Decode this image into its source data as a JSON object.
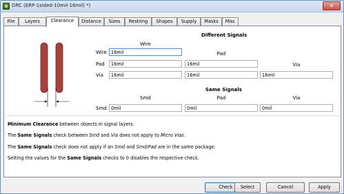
{
  "window": {
    "title": "DRC (ERP-1sided-10mil-16mil) *)",
    "close_label": "✕"
  },
  "tabs": [
    {
      "label": "File"
    },
    {
      "label": "Layers"
    },
    {
      "label": "Clearance"
    },
    {
      "label": "Distance"
    },
    {
      "label": "Sizes"
    },
    {
      "label": "Restring"
    },
    {
      "label": "Shapes"
    },
    {
      "label": "Supply"
    },
    {
      "label": "Masks"
    },
    {
      "label": "Misc"
    }
  ],
  "active_tab": "Clearance",
  "different_signals": {
    "title": "Different Signals",
    "col_wire": "Wire",
    "col_pad": "Pad",
    "col_via": "Via",
    "row_wire": "Wire",
    "row_pad": "Pad",
    "row_via": "Via",
    "wire_wire": "16mil",
    "pad_wire": "16mil",
    "pad_pad": "16mil",
    "via_wire": "16mil",
    "via_pad": "16mil",
    "via_via": "16mil"
  },
  "same_signals": {
    "title": "Same Signals",
    "col_smd": "Smd",
    "col_pad": "Pad",
    "col_via": "Via",
    "row_smd": "Smd",
    "smd_smd": "0mil",
    "smd_pad": "0mil",
    "smd_via": "0mil"
  },
  "info": {
    "line1_bold": "Minimum Clearance",
    "line1_rest": " between objects in signal layers.",
    "line2_pre": "The ",
    "line2_bold": "Same Signals",
    "line2_mid": " check between ",
    "line2_i1": "Smd",
    "line2_and": " and ",
    "line2_i2": "Via",
    "line2_post": " does not apply to ",
    "line2_i3": "Micro Vias",
    "line2_end": ".",
    "line3_pre": "The ",
    "line3_bold": "Same Signals",
    "line3_mid": " check does not apply if an ",
    "line3_i1": "Smd",
    "line3_and": " and ",
    "line3_i2": "Smd",
    "line3_slash": "/",
    "line3_i3": "Pad",
    "line3_end": " are in the same package.",
    "line4_pre": "Setting the values for the ",
    "line4_bold": "Same Signals",
    "line4_end": " checks to 0 disables the respective check."
  },
  "buttons": {
    "check": "Check",
    "select": "Select",
    "cancel": "Cancel",
    "apply": "Apply"
  },
  "colors": {
    "trace_fill": "#a8403c",
    "trace_stroke": "#6b2420"
  }
}
